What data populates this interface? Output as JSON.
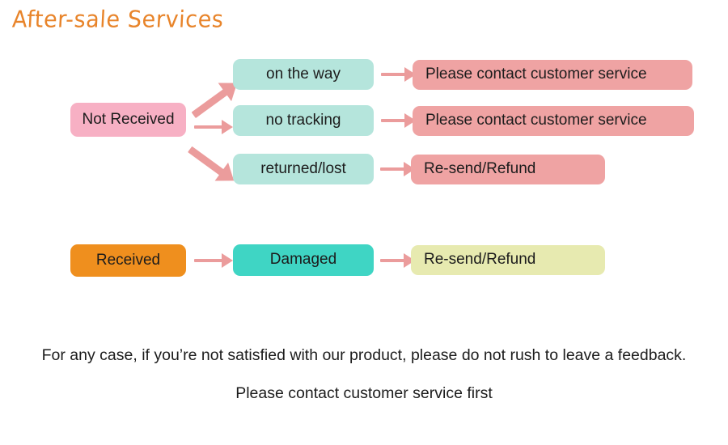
{
  "slide": {
    "background_color": "#ffffff",
    "title": "After-sale Services",
    "title_color": "#e8842a"
  },
  "palette": {
    "pink": "#f7b0c4",
    "mint": "#b5e5dc",
    "salmon": "#efa3a3",
    "orange": "#ef8f1e",
    "turquoise": "#3fd5c4",
    "yellow_green": "#e7eab0",
    "arrow": "#eb9c9c",
    "text": "#1c1c1c"
  },
  "flow": {
    "branch_not_received": {
      "source": {
        "label": "Not Received",
        "color": "#f7b0c4"
      },
      "rows": [
        {
          "condition": {
            "label": "on the way",
            "color": "#b5e5dc"
          },
          "action": {
            "label": "Please contact customer service",
            "color": "#efa3a3"
          }
        },
        {
          "condition": {
            "label": "no tracking",
            "color": "#b5e5dc"
          },
          "action": {
            "label": "Please contact customer service",
            "color": "#efa3a3"
          }
        },
        {
          "condition": {
            "label": "returned/lost",
            "color": "#b5e5dc"
          },
          "action": {
            "label": "Re-send/Refund",
            "color": "#efa3a3"
          }
        }
      ]
    },
    "branch_received": {
      "source": {
        "label": "Received",
        "color": "#ef8f1e"
      },
      "rows": [
        {
          "condition": {
            "label": "Damaged",
            "color": "#3fd5c4"
          },
          "action": {
            "label": "Re-send/Refund",
            "color": "#e7eab0"
          }
        }
      ]
    }
  },
  "footer": {
    "line1": "For any case, if you’re not satisfied with our product, please do not rush to leave a feedback.",
    "line2": "Please contact customer service first"
  }
}
